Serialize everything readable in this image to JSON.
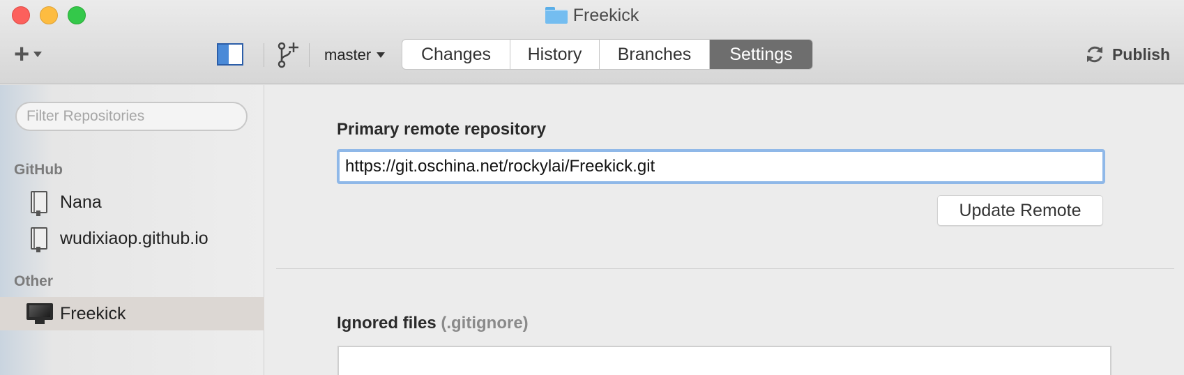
{
  "window": {
    "title": "Freekick",
    "title_icon": "folder-icon"
  },
  "toolbar": {
    "add_icon": "plus-icon",
    "sidebar_toggle_icon": "sidebar-toggle-icon",
    "branch_icon": "git-branch-add-icon",
    "branch": "master",
    "tabs": [
      {
        "label": "Changes",
        "active": false
      },
      {
        "label": "History",
        "active": false
      },
      {
        "label": "Branches",
        "active": false
      },
      {
        "label": "Settings",
        "active": true
      }
    ],
    "publish_label": "Publish",
    "publish_icon": "sync-icon"
  },
  "sidebar": {
    "filter_placeholder": "Filter Repositories",
    "groups": [
      {
        "label": "GitHub",
        "repos": [
          {
            "name": "Nana",
            "icon": "repo-book-icon"
          },
          {
            "name": "wudixiaop.github.io",
            "icon": "repo-book-icon"
          }
        ]
      },
      {
        "label": "Other",
        "repos": [
          {
            "name": "Freekick",
            "icon": "monitor-icon",
            "selected": true
          }
        ]
      }
    ]
  },
  "settings": {
    "remote_title": "Primary remote repository",
    "remote_url": "https://git.oschina.net/rockylai/Freekick.git",
    "update_button": "Update Remote",
    "ignored_title": "Ignored files",
    "ignored_suffix": "(.gitignore)"
  },
  "colors": {
    "active_tab": "#6e6e6e",
    "input_focus": "#8fb8e8",
    "selected_row": "#dcd7d3",
    "traffic_close": "#fc605c",
    "traffic_min": "#fdbc40",
    "traffic_max": "#34c84a"
  }
}
